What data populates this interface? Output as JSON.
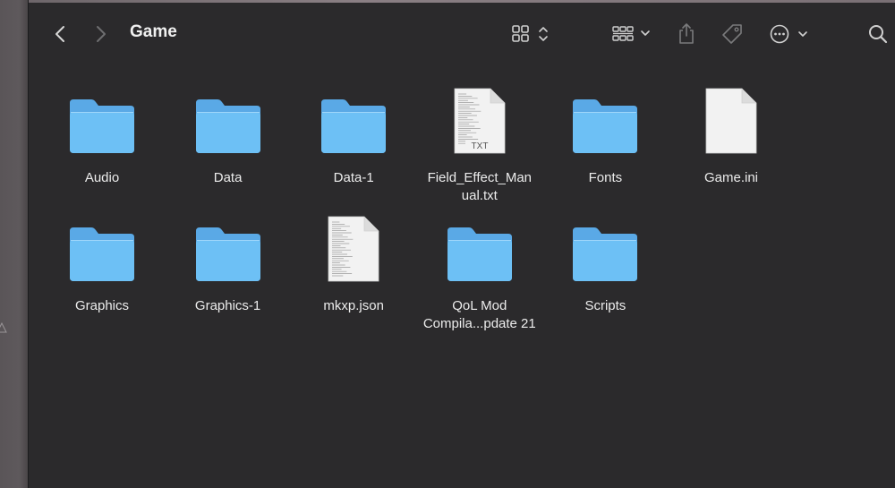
{
  "window": {
    "title": "Game"
  },
  "toolbar": {
    "icons": [
      "chevron-left-icon",
      "chevron-right-icon",
      "icon-view-icon",
      "group-by-icon",
      "share-icon",
      "tag-icon",
      "more-actions-icon",
      "search-icon"
    ]
  },
  "colors": {
    "folder_back": "#5aa9e6",
    "folder_front": "#6dc0f5",
    "background": "#2b2a2c"
  },
  "files": [
    {
      "name": "Audio",
      "kind": "folder"
    },
    {
      "name": "Data",
      "kind": "folder"
    },
    {
      "name": "Data-1",
      "kind": "folder"
    },
    {
      "name": "Field_Effect_Man\nual.txt",
      "kind": "txt",
      "badge": "TXT"
    },
    {
      "name": "Fonts",
      "kind": "folder"
    },
    {
      "name": "Game.ini",
      "kind": "blank"
    },
    {
      "name": "Graphics",
      "kind": "folder"
    },
    {
      "name": "Graphics-1",
      "kind": "folder"
    },
    {
      "name": "mkxp.json",
      "kind": "doc"
    },
    {
      "name": "QoL Mod\nCompila...pdate 21",
      "kind": "folder"
    },
    {
      "name": "Scripts",
      "kind": "folder"
    }
  ]
}
